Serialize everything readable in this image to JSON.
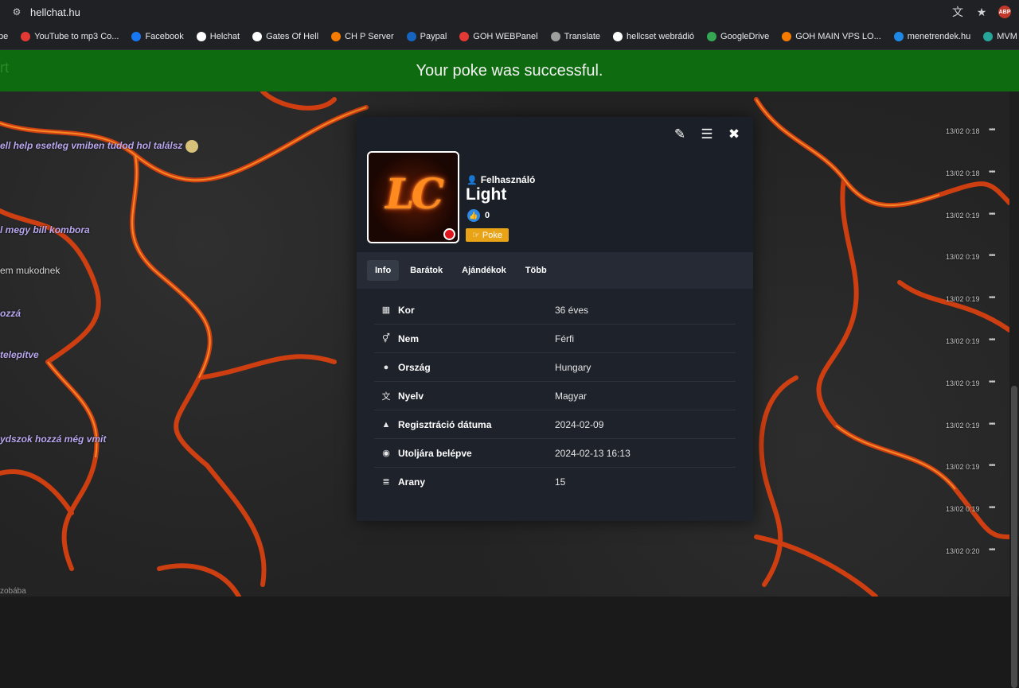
{
  "browser": {
    "url": "hellchat.hu",
    "bookmarks": [
      {
        "label": "be",
        "color": "#202124"
      },
      {
        "label": "YouTube to mp3 Co...",
        "color": "#e53935"
      },
      {
        "label": "Facebook",
        "color": "#1877f2"
      },
      {
        "label": "Helchat",
        "color": "#ffffff"
      },
      {
        "label": "Gates Of Hell",
        "color": "#ffffff"
      },
      {
        "label": "CH P Server",
        "color": "#f57c00"
      },
      {
        "label": "Paypal",
        "color": "#1565c0"
      },
      {
        "label": "GOH WEBPanel",
        "color": "#e53935"
      },
      {
        "label": "Translate",
        "color": "#9e9e9e"
      },
      {
        "label": "hellcset webrádió",
        "color": "#ffffff"
      },
      {
        "label": "GoogleDrive",
        "color": "#34a853"
      },
      {
        "label": "GOH MAIN VPS LO...",
        "color": "#f57c00"
      },
      {
        "label": "menetrendek.hu",
        "color": "#1e88e5"
      },
      {
        "label": "MVM",
        "color": "#26a69a"
      }
    ]
  },
  "notification": {
    "text": "Your poke was successful.",
    "ghost": "rt"
  },
  "chat": {
    "messages": [
      {
        "text": "ell help esetleg vmiben tudod hol találsz",
        "style": "italic",
        "emoji": true
      },
      {
        "text": "l megy bill kombora",
        "style": "italic"
      },
      {
        "text": "em mukodnek",
        "style": "plain"
      },
      {
        "text": "ozzá",
        "style": "italic"
      },
      {
        "text": "telepítve",
        "style": "italic"
      },
      {
        "text": "ydszok hozzá még vmit",
        "style": "italic"
      }
    ],
    "timestamps": [
      "13/02 0:18",
      "13/02 0:18",
      "13/02 0:19",
      "13/02 0:19",
      "13/02 0:19",
      "13/02 0:19",
      "13/02 0:19",
      "13/02 0:19",
      "13/02 0:19",
      "13/02 0:19",
      "13/02 0:20"
    ],
    "footer": "zobába"
  },
  "profile": {
    "role": "Felhasználó",
    "username": "Light",
    "likes": "0",
    "poke_label": "Poke",
    "avatar_text": "LC",
    "status_color": "#e0161e",
    "tabs": [
      "Info",
      "Barátok",
      "Ajándékok",
      "Több"
    ],
    "active_tab": "Info",
    "info": [
      {
        "label": "Kor",
        "value": "36 éves",
        "icon": "calendar-icon"
      },
      {
        "label": "Nem",
        "value": "Férfi",
        "icon": "gender-icon"
      },
      {
        "label": "Ország",
        "value": "Hungary",
        "icon": "globe-icon"
      },
      {
        "label": "Nyelv",
        "value": "Magyar",
        "icon": "language-icon"
      },
      {
        "label": "Regisztráció dátuma",
        "value": "2024-02-09",
        "icon": "user-icon"
      },
      {
        "label": "Utoljára belépve",
        "value": "2024-02-13 16:13",
        "icon": "eye-icon"
      },
      {
        "label": "Arany",
        "value": "15",
        "icon": "coins-icon"
      }
    ]
  },
  "colors": {
    "notification_bg": "#0f6b0f",
    "poke_button": "#e8a317",
    "chat_text": "#b9a8f0"
  }
}
